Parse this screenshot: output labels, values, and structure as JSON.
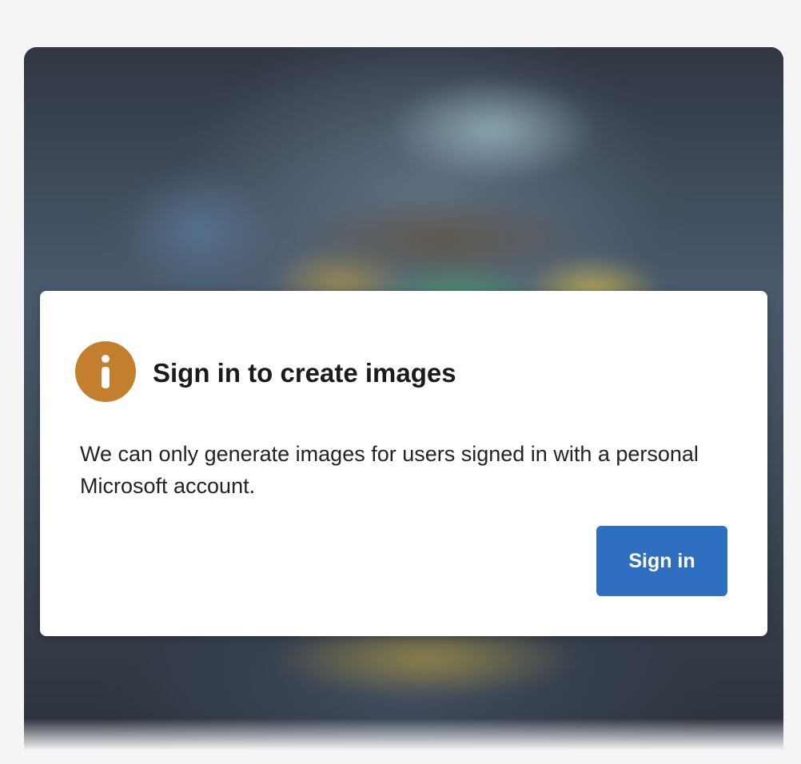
{
  "dialog": {
    "title": "Sign in to create images",
    "message": "We can only generate images for users signed in with a personal Microsoft account.",
    "icon": "info-icon",
    "sign_in_label": "Sign in"
  },
  "colors": {
    "page_background": "#f5f5f5",
    "icon_accent": "#c47f2e",
    "button_primary": "#2f6fbf",
    "dialog_background": "#ffffff"
  }
}
